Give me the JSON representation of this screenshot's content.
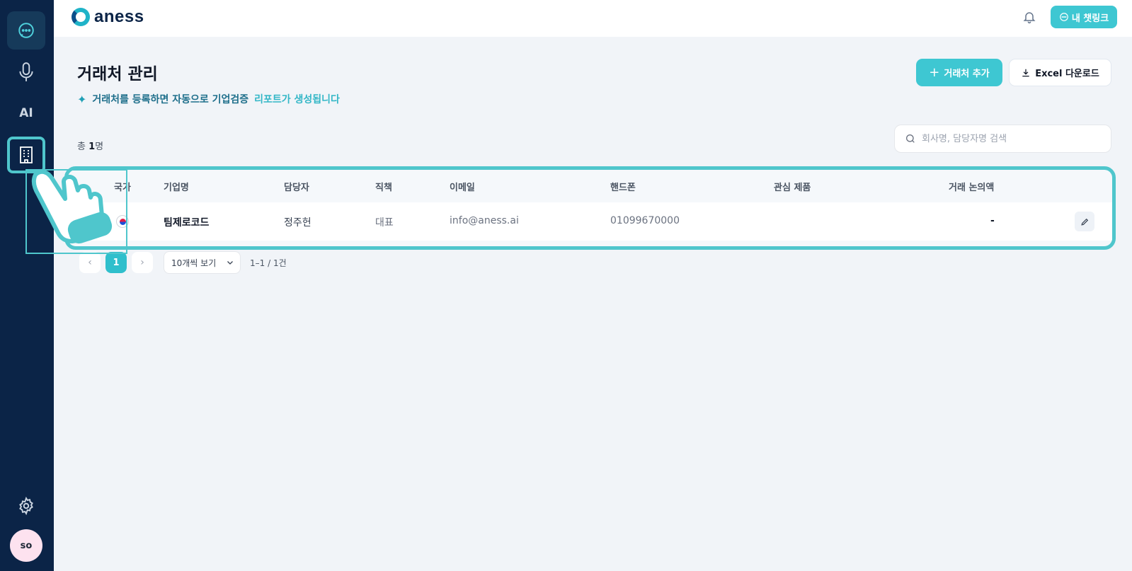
{
  "app": {
    "logo_text": "aness"
  },
  "sidebar": {
    "items": [
      {
        "name": "chat",
        "icon": "chat-bubble-icon"
      },
      {
        "name": "voice",
        "icon": "microphone-icon"
      },
      {
        "name": "ai",
        "label": "AI"
      },
      {
        "name": "companies",
        "icon": "building-icon",
        "active": true
      },
      {
        "name": "settings",
        "icon": "gear-icon"
      }
    ],
    "avatar": "so"
  },
  "topbar": {
    "notification_icon": "bell-icon",
    "chatlink_label": "내 챗링크"
  },
  "header": {
    "title": "거래처 관리",
    "subtitle_a": "거래처를 등록하면 자동으로 기업검증",
    "subtitle_b": "리포트가 생성됩니다",
    "add_label": "거래처 추가",
    "excel_label": "Excel 다운로드"
  },
  "summary": {
    "prefix": "총",
    "count": "1",
    "suffix": "명"
  },
  "search": {
    "placeholder": "회사명, 담당자명 검색",
    "value": ""
  },
  "table": {
    "columns": [
      "국가",
      "기업명",
      "담당자",
      "직책",
      "이메일",
      "핸드폰",
      "관심 제품",
      "거래 논의액"
    ],
    "rows": [
      {
        "country": "KR",
        "company": "팀제로코드",
        "contact": "정주헌",
        "position": "대표",
        "email": "info@aness.ai",
        "phone": "01099670000",
        "product": "",
        "amount": "-"
      }
    ]
  },
  "pagination": {
    "current": "1",
    "page_size": "10개씩 보기",
    "range": "1–1 / 1건"
  },
  "colors": {
    "sidebar": "#0b2447",
    "accent": "#3ec7d2",
    "highlight": "#4fc6cc"
  }
}
